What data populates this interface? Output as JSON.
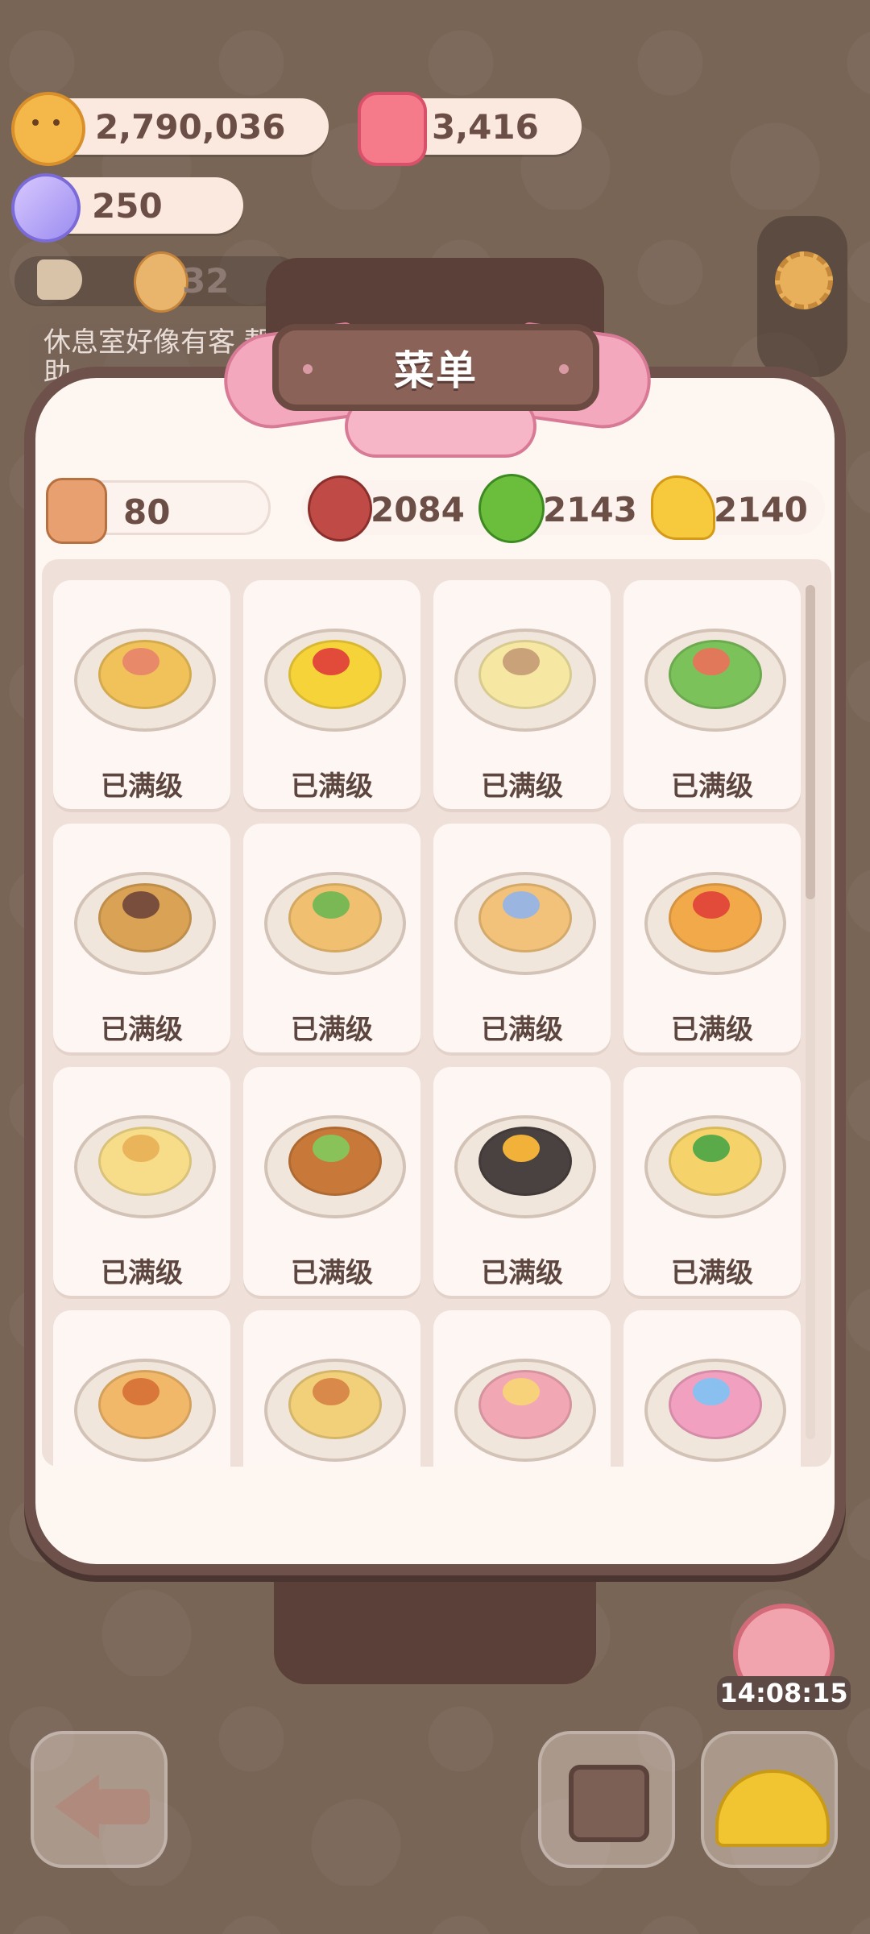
{
  "currencies": {
    "cookies": {
      "value": "2,790,036",
      "icon": "cookie-coin-icon"
    },
    "gems": {
      "value": "3,416",
      "icon": "pink-gem-icon"
    },
    "candy": {
      "value": "250",
      "icon": "candy-icon"
    }
  },
  "notice": {
    "count": "32",
    "hint": "休息室好像有客 帮助"
  },
  "menu": {
    "title": "菜单",
    "ingredients": [
      {
        "name": "spoon",
        "value": "80",
        "icon": "spoon-icon"
      },
      {
        "name": "meat",
        "value": "2084",
        "icon": "meat-icon"
      },
      {
        "name": "broccoli",
        "value": "2143",
        "icon": "broccoli-icon"
      },
      {
        "name": "cheese",
        "value": "2140",
        "icon": "cheese-icon"
      }
    ],
    "items": [
      {
        "label": "已满级",
        "dish": "sandwich"
      },
      {
        "label": "已满级",
        "dish": "omelette-rice"
      },
      {
        "label": "已满级",
        "dish": "cream-soup"
      },
      {
        "label": "已满级",
        "dish": "salad-bowl"
      },
      {
        "label": "已满级",
        "dish": "tempura-udon"
      },
      {
        "label": "已满级",
        "dish": "ramen"
      },
      {
        "label": "已满级",
        "dish": "pancakes"
      },
      {
        "label": "已满级",
        "dish": "pizza"
      },
      {
        "label": "已满级",
        "dish": "cheese-bread"
      },
      {
        "label": "已满级",
        "dish": "burger-tower"
      },
      {
        "label": "已满级",
        "dish": "bibimbap"
      },
      {
        "label": "已满级",
        "dish": "cheese-flowers"
      },
      {
        "label": "",
        "dish": "spaghetti"
      },
      {
        "label": "",
        "dish": "breakfast-platter"
      },
      {
        "label": "",
        "dish": "dessert-plate"
      },
      {
        "label": "",
        "dish": "ice-cream-sundae"
      }
    ]
  },
  "timer": "14:08:15",
  "colors": {
    "panel": "#fdf6f1",
    "border": "#6e514a",
    "ribbon": "#f4a8bd",
    "text": "#5d463f"
  }
}
